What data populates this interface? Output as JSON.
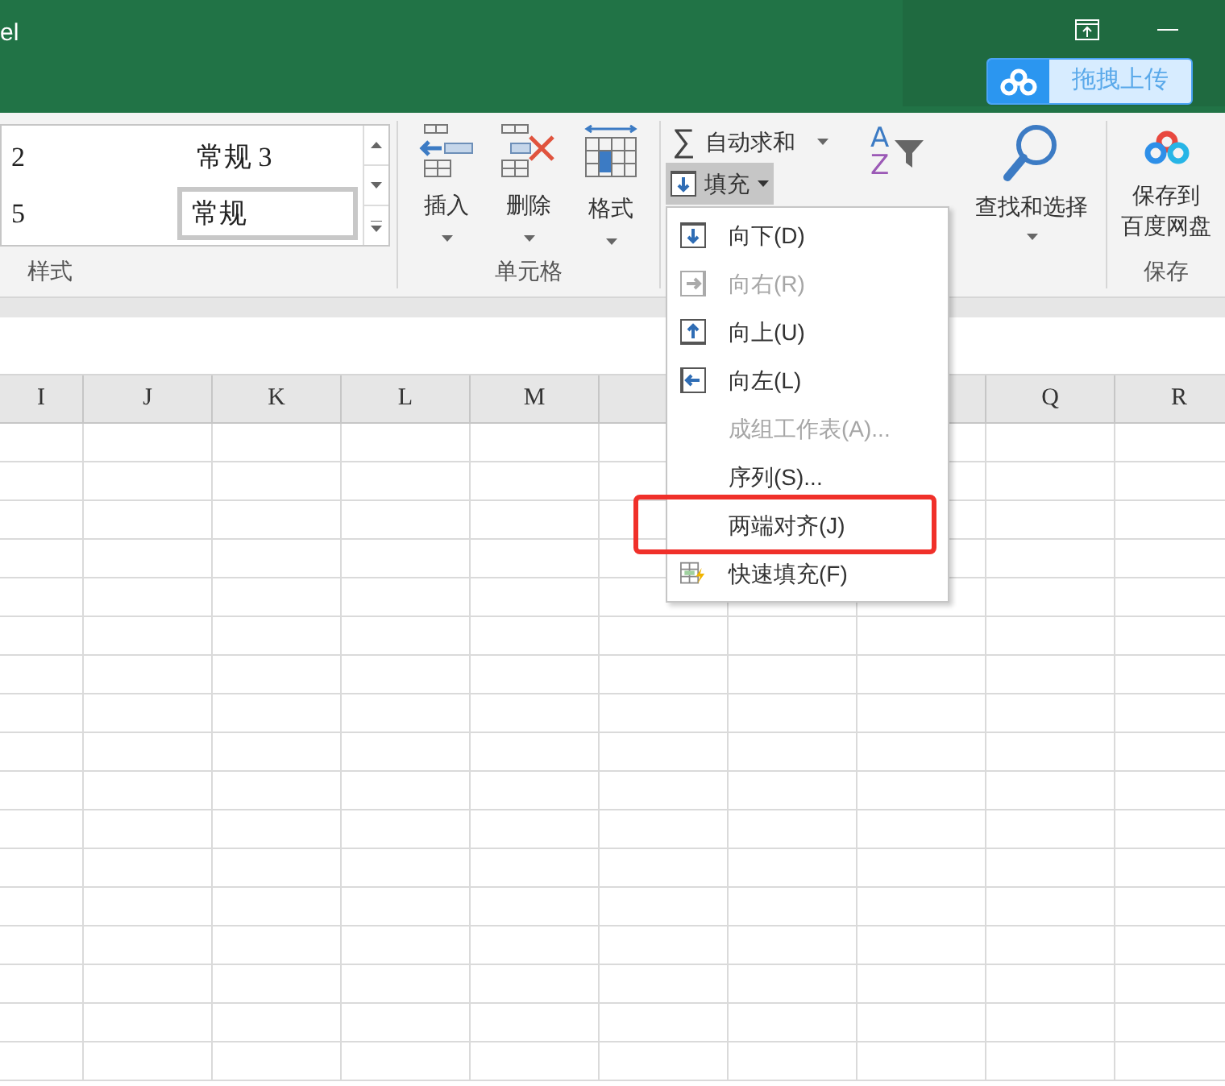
{
  "window": {
    "title": "el"
  },
  "cloud_upload": {
    "label": "拖拽上传"
  },
  "styles_gallery": {
    "items": [
      {
        "label": "2",
        "selected": false
      },
      {
        "label": "常规 3",
        "selected": false
      },
      {
        "label": "5",
        "selected": false
      },
      {
        "label": "常规",
        "selected": true
      }
    ],
    "group_label": "样式"
  },
  "cells_group": {
    "buttons": [
      {
        "label": "插入"
      },
      {
        "label": "删除"
      },
      {
        "label": "格式"
      }
    ],
    "group_label": "单元格"
  },
  "editing_group": {
    "autosum": {
      "icon": "∑",
      "label": "自动求和"
    },
    "fill": {
      "label": "填充",
      "open": true
    },
    "sort_filter": {
      "icon_letters": [
        "A",
        "Z"
      ]
    },
    "find_select": {
      "label": "查找和选择"
    }
  },
  "save_group": {
    "button": {
      "lines": [
        "保存到",
        "百度网盘"
      ]
    },
    "group_label": "保存"
  },
  "fill_menu": [
    {
      "label": "向下(D)",
      "disabled": false,
      "marked": false
    },
    {
      "label": "向右(R)",
      "disabled": true,
      "marked": false
    },
    {
      "label": "向上(U)",
      "disabled": false,
      "marked": false
    },
    {
      "label": "向左(L)",
      "disabled": false,
      "marked": false
    },
    {
      "label": "成组工作表(A)...",
      "disabled": true,
      "marked": false
    },
    {
      "label": "序列(S)...",
      "disabled": false,
      "marked": false
    },
    {
      "label": "两端对齐(J)",
      "disabled": false,
      "marked": true
    },
    {
      "label": "快速填充(F)",
      "disabled": false,
      "marked": false
    }
  ],
  "column_headers": [
    "I",
    "J",
    "K",
    "L",
    "M",
    "Q",
    "R"
  ]
}
